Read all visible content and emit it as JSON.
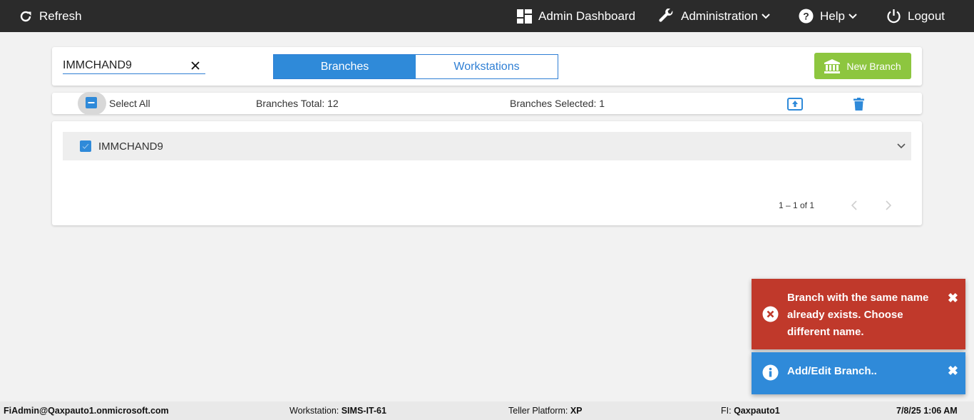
{
  "nav": {
    "refresh": "Refresh",
    "admin_dashboard": "Admin Dashboard",
    "administration": "Administration",
    "help": "Help",
    "logout": "Logout"
  },
  "search": {
    "value": "IMMCHAND9",
    "placeholder": ""
  },
  "tabs": {
    "branches": "Branches",
    "workstations": "Workstations",
    "active": "Branches"
  },
  "new_branch": "New Branch",
  "bar": {
    "select_all": "Select All",
    "total": "Branches Total: 12",
    "selected": "Branches Selected: 1"
  },
  "list": {
    "items": [
      {
        "label": "IMMCHAND9",
        "checked": true
      }
    ],
    "pager": "1 – 1 of 1"
  },
  "toasts": {
    "error": "Branch with the same name already exists. Choose different name.",
    "info": "Add/Edit Branch.."
  },
  "status": {
    "user": "FiAdmin@Qaxpauto1.onmicrosoft.com",
    "workstation_label": "Workstation: ",
    "workstation": "SIMS-IT-61",
    "platform_label": "Teller Platform: ",
    "platform": "XP",
    "fi_label": "FI: ",
    "fi": "Qaxpauto1",
    "datetime": "7/8/25 1:06 AM"
  },
  "colors": {
    "nav_bg": "#2b2b2b",
    "accent": "#2f8ad9",
    "new_branch": "#8dc63f",
    "error": "#c0392b"
  }
}
